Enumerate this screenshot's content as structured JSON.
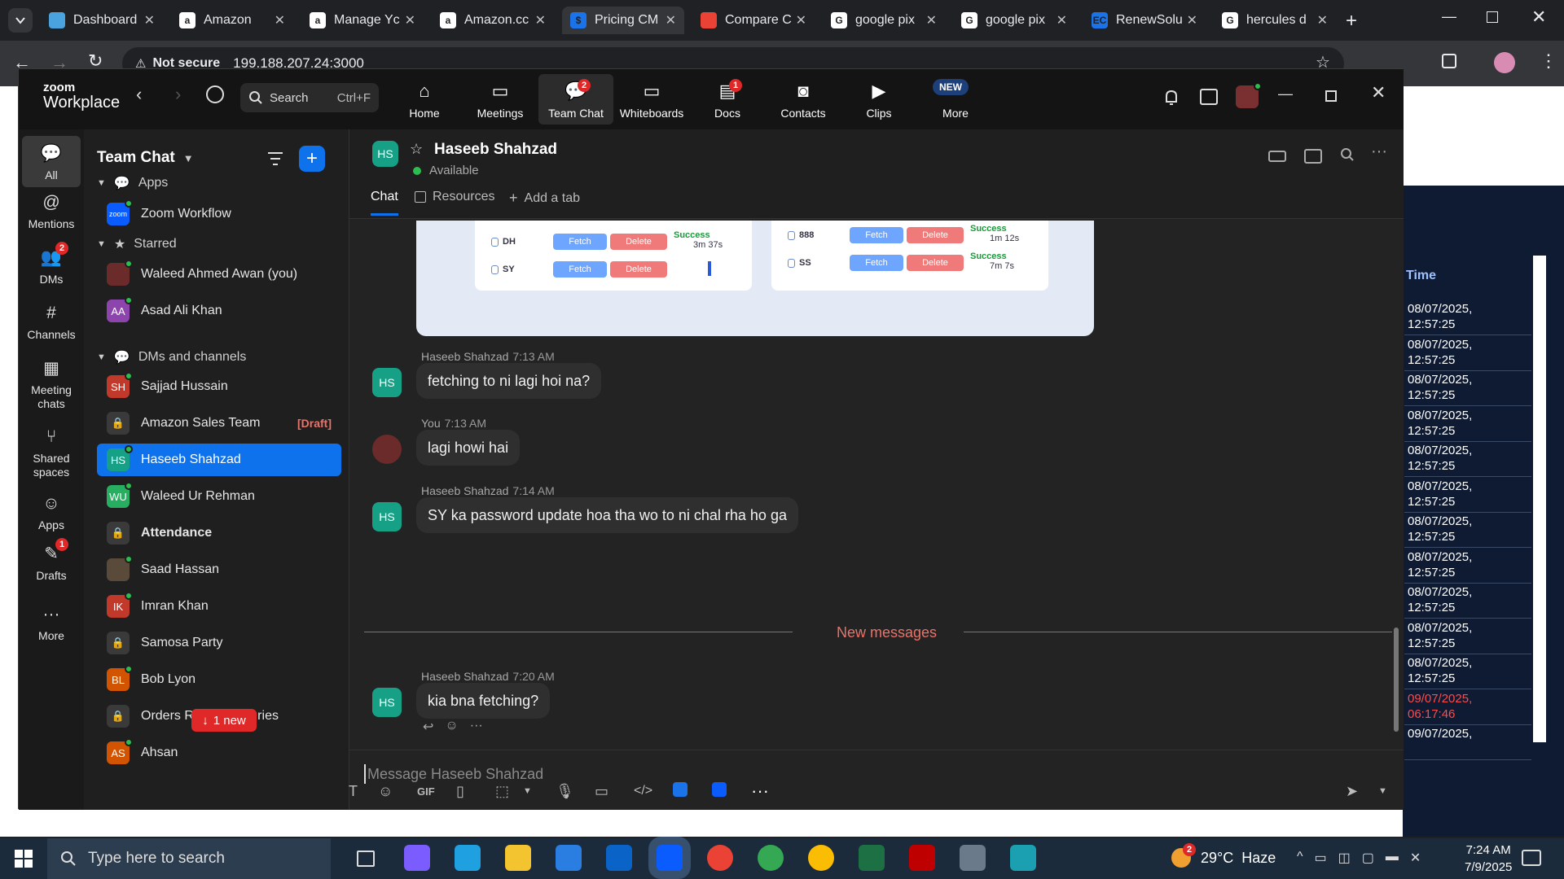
{
  "browser": {
    "tabs": [
      {
        "label": "Dashboard",
        "icon": "diamond-icon",
        "color": "#4aa3df"
      },
      {
        "label": "Amazon",
        "icon": "amazon-icon",
        "color": "#ffffff"
      },
      {
        "label": "Manage Yc",
        "icon": "amazon-icon",
        "color": "#ffffff"
      },
      {
        "label": "Amazon.cc",
        "icon": "amazon-icon",
        "color": "#ffffff"
      },
      {
        "label": "Pricing CM",
        "icon": "dollar-icon",
        "color": "#1a73e8"
      },
      {
        "label": "Compare C",
        "icon": "chart-icon",
        "color": "#ea4335"
      },
      {
        "label": "google pix",
        "icon": "google-icon",
        "color": "#ffffff"
      },
      {
        "label": "google pix",
        "icon": "google-icon",
        "color": "#ffffff"
      },
      {
        "label": "RenewSolu",
        "icon": "ec-icon",
        "color": "#1a73e8"
      },
      {
        "label": "hercules d",
        "icon": "google-icon",
        "color": "#ffffff"
      }
    ],
    "not_secure": "Not secure",
    "url": "199.188.207.24:3000"
  },
  "zoom": {
    "brand_top": "zoom",
    "brand_bottom": "Workplace",
    "search_label": "Search",
    "search_shortcut": "Ctrl+F",
    "nav": [
      {
        "label": "Home",
        "icon": "home-icon",
        "badge": ""
      },
      {
        "label": "Meetings",
        "icon": "video-camera-icon",
        "badge": ""
      },
      {
        "label": "Team Chat",
        "icon": "chat-bubbles-icon",
        "badge": "2"
      },
      {
        "label": "Whiteboards",
        "icon": "whiteboard-icon",
        "badge": ""
      },
      {
        "label": "Docs",
        "icon": "doc-icon",
        "badge": "1"
      },
      {
        "label": "Contacts",
        "icon": "contacts-icon",
        "badge": ""
      },
      {
        "label": "Clips",
        "icon": "clips-icon",
        "badge": ""
      },
      {
        "label": "More",
        "icon": "more-icon",
        "badge": "NEW"
      }
    ],
    "rail": [
      {
        "label": "All",
        "icon": "chat-icon",
        "badge": ""
      },
      {
        "label": "Mentions",
        "icon": "at-icon",
        "badge": ""
      },
      {
        "label": "DMs",
        "icon": "people-icon",
        "badge": "2"
      },
      {
        "label": "Channels",
        "icon": "hash-icon",
        "badge": ""
      },
      {
        "label": "Meeting chats",
        "icon": "calendar-icon",
        "badge": ""
      },
      {
        "label": "Shared spaces",
        "icon": "share-icon",
        "badge": ""
      },
      {
        "label": "Apps",
        "icon": "apps-icon",
        "badge": ""
      },
      {
        "label": "Drafts",
        "icon": "drafts-icon",
        "badge": "1"
      },
      {
        "label": "More",
        "icon": "ellipsis-icon",
        "badge": ""
      }
    ],
    "sidebar": {
      "title": "Team Chat",
      "sections": {
        "apps": "Apps",
        "starred": "Starred",
        "dms": "DMs and channels"
      },
      "apps": [
        {
          "name": "Zoom Workflow",
          "initials": "zoom",
          "color": "#0b5cff"
        }
      ],
      "starred": [
        {
          "name": "Waleed Ahmed Awan (you)",
          "initials": "",
          "color": "#6b2b2b"
        },
        {
          "name": "Asad Ali Khan",
          "initials": "AA",
          "color": "#8e44ad"
        }
      ],
      "dms": [
        {
          "name": "Sajjad Hussain",
          "initials": "SH",
          "color": "#c0392b",
          "tag": ""
        },
        {
          "name": "Amazon Sales Team",
          "initials": "",
          "color": "#3a3a3a",
          "tag": "[Draft]"
        },
        {
          "name": "Haseeb Shahzad",
          "initials": "HS",
          "color": "#16a085",
          "tag": ""
        },
        {
          "name": "Waleed Ur Rehman",
          "initials": "WU",
          "color": "#27ae60",
          "tag": ""
        },
        {
          "name": "Attendance",
          "initials": "",
          "color": "#3a3a3a",
          "tag": ""
        },
        {
          "name": "Saad Hassan",
          "initials": "",
          "color": "#5a4a3a",
          "tag": ""
        },
        {
          "name": "Imran Khan",
          "initials": "IK",
          "color": "#c0392b",
          "tag": ""
        },
        {
          "name": "Samosa Party",
          "initials": "",
          "color": "#3a3a3a",
          "tag": ""
        },
        {
          "name": "Bob Lyon",
          "initials": "BL",
          "color": "#d35400",
          "tag": ""
        },
        {
          "name": "Orders Realated Quries",
          "initials": "",
          "color": "#3a3a3a",
          "tag": ""
        },
        {
          "name": "Ahsan",
          "initials": "AS",
          "color": "#d35400",
          "tag": ""
        }
      ],
      "new_pill": "1 new"
    },
    "chat": {
      "contact_name": "Haseeb Shahzad",
      "contact_initials": "HS",
      "status": "Available",
      "tabs": [
        "Chat",
        "Resources",
        "Add a tab"
      ],
      "messages": [
        {
          "sender": "Haseeb Shahzad",
          "time": "7:13 AM",
          "text": "fetching to ni lagi hoi na?",
          "mine": false
        },
        {
          "sender": "You",
          "time": "7:13 AM",
          "text": "lagi howi hai",
          "mine": true
        },
        {
          "sender": "Haseeb Shahzad",
          "time": "7:14 AM",
          "text": "SY ka password update hoa tha wo to ni chal rha ho ga",
          "mine": false
        },
        {
          "sender": "Haseeb Shahzad",
          "time": "7:20 AM",
          "text": "kia bna fetching?",
          "mine": false
        }
      ],
      "new_messages": "New messages",
      "composer_placeholder": "Message Haseeb Shahzad",
      "composer_gif": "GIF",
      "preview": {
        "left": [
          {
            "name": "DH",
            "fetch": "Fetch",
            "delete": "Delete",
            "status": "Success",
            "time": "3m 37s"
          },
          {
            "name": "SY",
            "fetch": "Fetch",
            "delete": "Delete",
            "status": "",
            "time": ""
          }
        ],
        "right": [
          {
            "name": "888",
            "fetch": "Fetch",
            "delete": "Delete",
            "status": "Success",
            "time": "1m 12s"
          },
          {
            "name": "SS",
            "fetch": "Fetch",
            "delete": "Delete",
            "status": "Success",
            "time": "7m 7s"
          }
        ]
      }
    }
  },
  "background_page": {
    "time_header": "Time",
    "rows": [
      {
        "date": "08/07/2025,",
        "time": "12:57:25",
        "red": false
      },
      {
        "date": "08/07/2025,",
        "time": "12:57:25",
        "red": false
      },
      {
        "date": "08/07/2025,",
        "time": "12:57:25",
        "red": false
      },
      {
        "date": "08/07/2025,",
        "time": "12:57:25",
        "red": false
      },
      {
        "date": "08/07/2025,",
        "time": "12:57:25",
        "red": false
      },
      {
        "date": "08/07/2025,",
        "time": "12:57:25",
        "red": false
      },
      {
        "date": "08/07/2025,",
        "time": "12:57:25",
        "red": false
      },
      {
        "date": "08/07/2025,",
        "time": "12:57:25",
        "red": false
      },
      {
        "date": "08/07/2025,",
        "time": "12:57:25",
        "red": false
      },
      {
        "date": "08/07/2025,",
        "time": "12:57:25",
        "red": false
      },
      {
        "date": "08/07/2025,",
        "time": "12:57:25",
        "red": false
      },
      {
        "date": "09/07/2025,",
        "time": "06:17:46",
        "red": true
      },
      {
        "date": "09/07/2025,",
        "time": "",
        "red": false
      }
    ]
  },
  "taskbar": {
    "search_placeholder": "Type here to search",
    "weather": "29°C  Haze",
    "weather_badge": "2",
    "time": "7:24 AM",
    "date": "7/9/2025"
  }
}
